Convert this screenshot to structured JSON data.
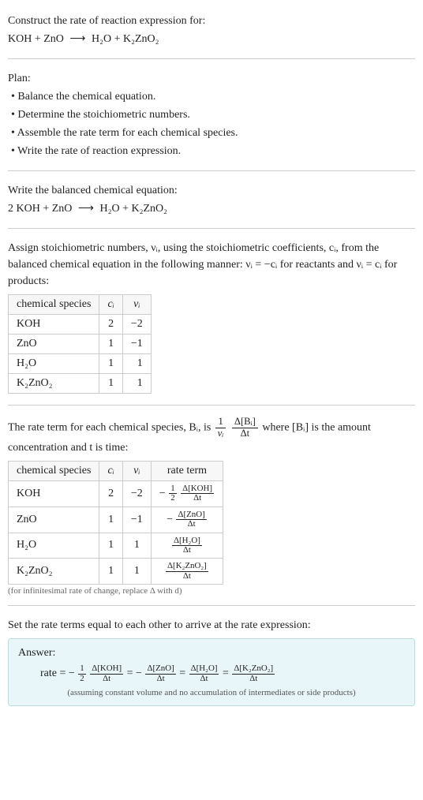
{
  "intro": {
    "construct": "Construct the rate of reaction expression for:",
    "equation_lhs": "KOH + ZnO",
    "arrow": "⟶",
    "equation_rhs": "H₂O + K₂ZnO₂"
  },
  "plan": {
    "heading": "Plan:",
    "items": [
      "• Balance the chemical equation.",
      "• Determine the stoichiometric numbers.",
      "• Assemble the rate term for each chemical species.",
      "• Write the rate of reaction expression."
    ]
  },
  "balanced": {
    "heading": "Write the balanced chemical equation:",
    "lhs": "2 KOH + ZnO",
    "arrow": "⟶",
    "rhs": "H₂O + K₂ZnO₂"
  },
  "stoich": {
    "intro": "Assign stoichiometric numbers, νᵢ, using the stoichiometric coefficients, cᵢ, from the balanced chemical equation in the following manner: νᵢ = −cᵢ for reactants and νᵢ = cᵢ for products:",
    "headers": {
      "species": "chemical species",
      "ci": "cᵢ",
      "vi": "νᵢ"
    },
    "rows": [
      {
        "species": "KOH",
        "ci": "2",
        "vi": "−2"
      },
      {
        "species": "ZnO",
        "ci": "1",
        "vi": "−1"
      },
      {
        "species": "H₂O",
        "ci": "1",
        "vi": "1"
      },
      {
        "species": "K₂ZnO₂",
        "ci": "1",
        "vi": "1"
      }
    ]
  },
  "rateterm": {
    "intro_a": "The rate term for each chemical species, Bᵢ, is ",
    "frac1_num": "1",
    "frac1_den": "νᵢ",
    "frac2_num": "Δ[Bᵢ]",
    "frac2_den": "Δt",
    "intro_b": " where [Bᵢ] is the amount concentration and t is time:",
    "headers": {
      "species": "chemical species",
      "ci": "cᵢ",
      "vi": "νᵢ",
      "rate": "rate term"
    },
    "rows": [
      {
        "species": "KOH",
        "ci": "2",
        "vi": "−2",
        "neg": "−",
        "coef_num": "1",
        "coef_den": "2",
        "main_num": "Δ[KOH]",
        "main_den": "Δt"
      },
      {
        "species": "ZnO",
        "ci": "1",
        "vi": "−1",
        "neg": "−",
        "coef_num": "",
        "coef_den": "",
        "main_num": "Δ[ZnO]",
        "main_den": "Δt"
      },
      {
        "species": "H₂O",
        "ci": "1",
        "vi": "1",
        "neg": "",
        "coef_num": "",
        "coef_den": "",
        "main_num": "Δ[H₂O]",
        "main_den": "Δt"
      },
      {
        "species": "K₂ZnO₂",
        "ci": "1",
        "vi": "1",
        "neg": "",
        "coef_num": "",
        "coef_den": "",
        "main_num": "Δ[K₂ZnO₂]",
        "main_den": "Δt"
      }
    ],
    "note": "(for infinitesimal rate of change, replace Δ with d)"
  },
  "final": {
    "heading": "Set the rate terms equal to each other to arrive at the rate expression:",
    "answer_label": "Answer:",
    "rate_eq": "rate = ",
    "eq": " = ",
    "neg": "−",
    "half_num": "1",
    "half_den": "2",
    "t1_num": "Δ[KOH]",
    "t1_den": "Δt",
    "t2_num": "Δ[ZnO]",
    "t2_den": "Δt",
    "t3_num": "Δ[H₂O]",
    "t3_den": "Δt",
    "t4_num": "Δ[K₂ZnO₂]",
    "t4_den": "Δt",
    "note": "(assuming constant volume and no accumulation of intermediates or side products)"
  }
}
